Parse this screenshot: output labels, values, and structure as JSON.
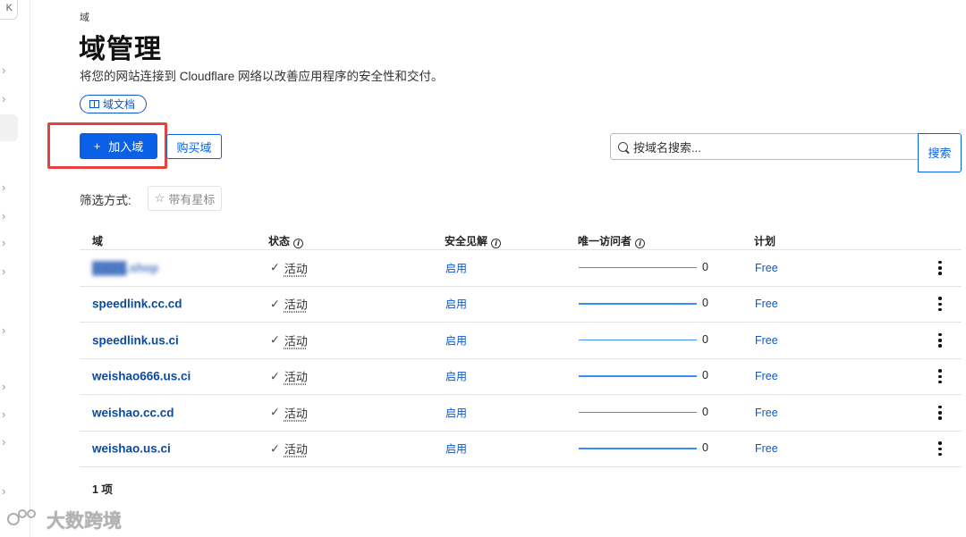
{
  "sidebar": {
    "collapse_label": "K",
    "chevron_glyph": "›"
  },
  "header": {
    "breadcrumb": "域",
    "title": "域管理",
    "description": "将您的网站连接到 Cloudflare 网络以改善应用程序的安全性和交付。",
    "docs_button": "域文档"
  },
  "toolbar": {
    "add_domain_icon": "+",
    "add_domain_label": "加入域",
    "buy_domain_label": "购买域",
    "search_placeholder": "按域名搜索...",
    "search_button": "搜索"
  },
  "filter": {
    "label": "筛选方式:",
    "starred_label": "带有星标",
    "star_glyph": "☆"
  },
  "table": {
    "headers": {
      "domain": "域",
      "status": "状态",
      "security": "安全见解",
      "visitors": "唯一访问者",
      "plan": "计划"
    },
    "rows": [
      {
        "domain": "████.shop",
        "status": "活动",
        "security": "启用",
        "visitors": "0",
        "plan": "Free",
        "blurred": true
      },
      {
        "domain": "speedlink.cc.cd",
        "status": "活动",
        "security": "启用",
        "visitors": "0",
        "plan": "Free"
      },
      {
        "domain": "speedlink.us.ci",
        "status": "活动",
        "security": "启用",
        "visitors": "0",
        "plan": "Free"
      },
      {
        "domain": "weishao666.us.ci",
        "status": "活动",
        "security": "启用",
        "visitors": "0",
        "plan": "Free"
      },
      {
        "domain": "weishao.cc.cd",
        "status": "活动",
        "security": "启用",
        "visitors": "0",
        "plan": "Free"
      },
      {
        "domain": "weishao.us.ci",
        "status": "活动",
        "security": "启用",
        "visitors": "0",
        "plan": "Free"
      }
    ],
    "check_glyph": "✓",
    "info_glyph": "i"
  },
  "footer": {
    "count": "1 项"
  },
  "watermark": {
    "text": "大数跨境"
  },
  "colors": {
    "primary": "#0a61e8",
    "link": "#0b57d0",
    "highlight_box": "#e8413b"
  }
}
